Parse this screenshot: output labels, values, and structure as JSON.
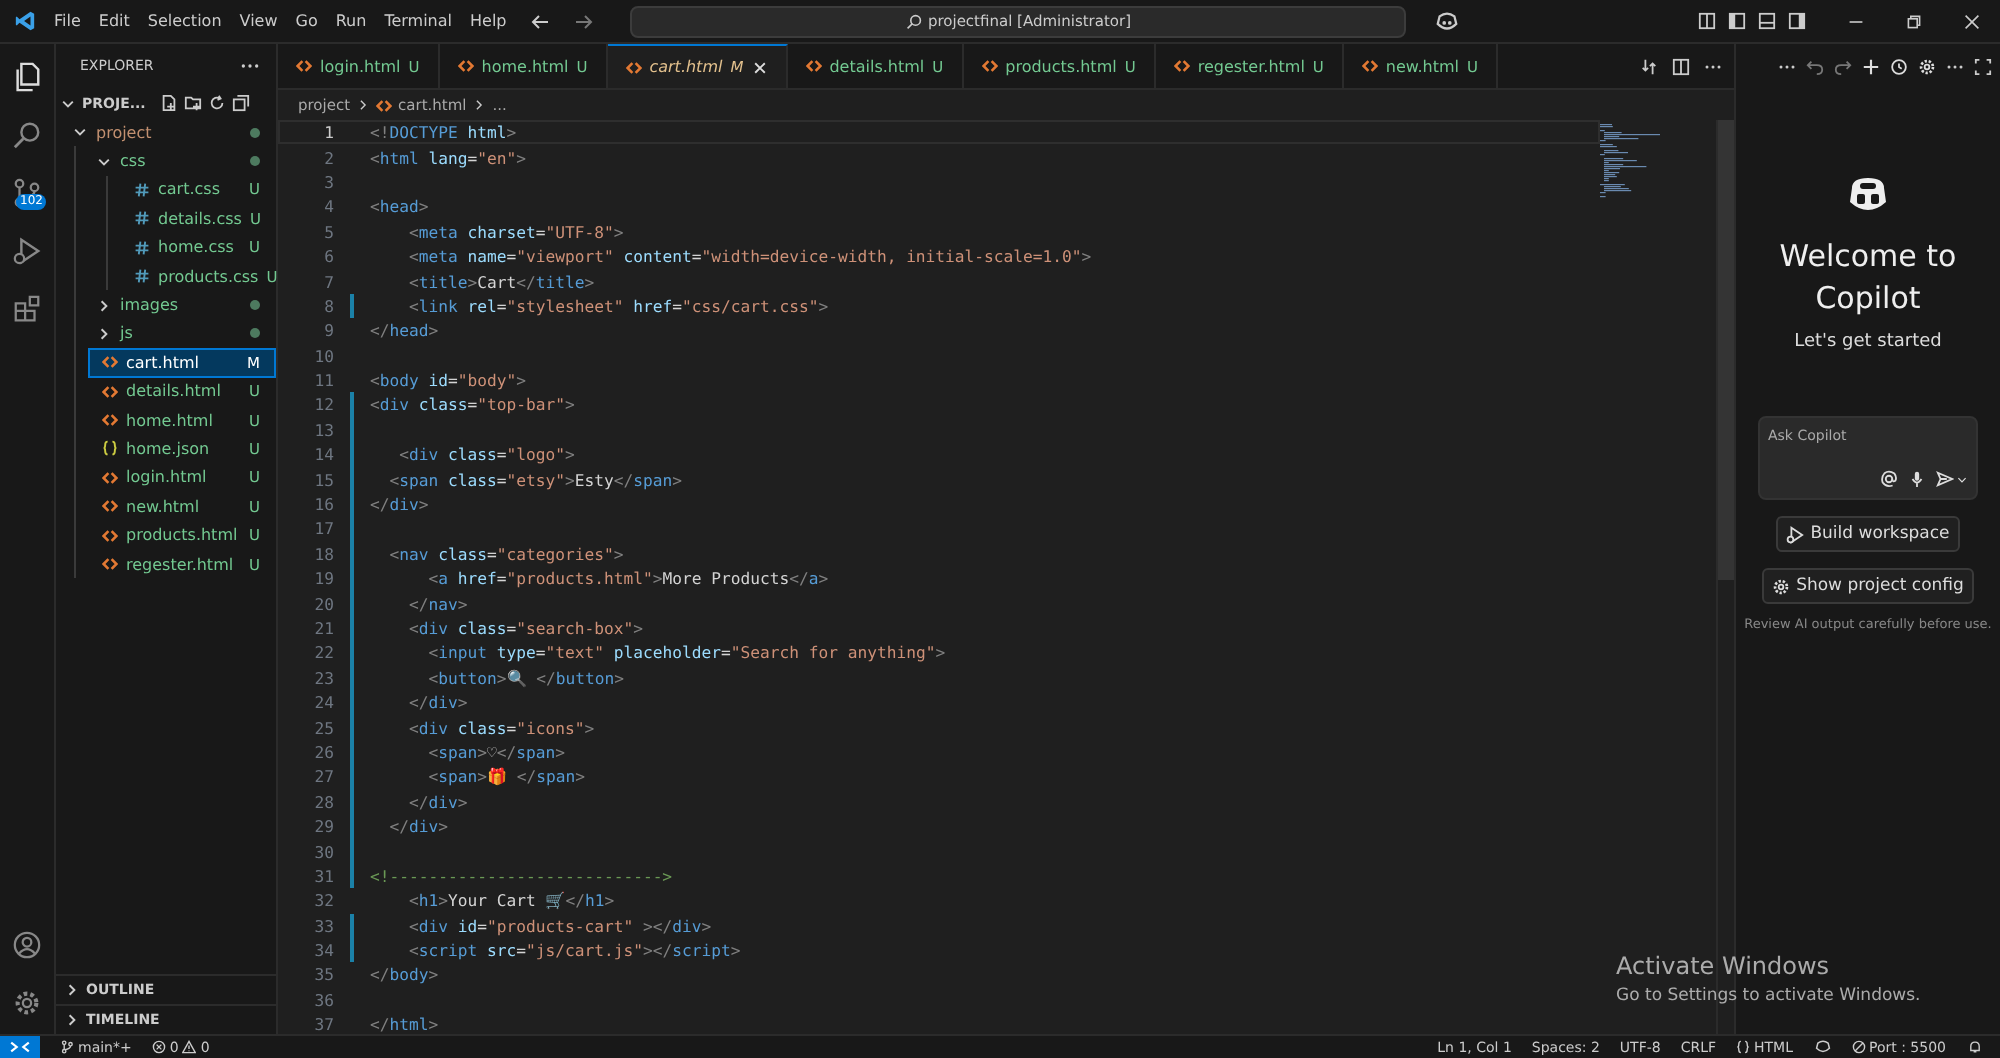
{
  "title_bar": {
    "menu": [
      "File",
      "Edit",
      "Selection",
      "View",
      "Go",
      "Run",
      "Terminal",
      "Help"
    ],
    "search": "projectfinal [Administrator]"
  },
  "activity_bar": {
    "source_control_badge": "102"
  },
  "explorer": {
    "title": "EXPLORER",
    "section": "PROJE...",
    "tree": [
      {
        "name": "project",
        "kind": "folder",
        "expanded": true,
        "children": [
          {
            "name": "css",
            "kind": "folder",
            "expanded": true,
            "children": [
              {
                "name": "cart.css",
                "kind": "css",
                "status": "U",
                "modified": false,
                "selected": false
              },
              {
                "name": "details.css",
                "kind": "css",
                "status": "U",
                "modified": false,
                "selected": false
              },
              {
                "name": "home.css",
                "kind": "css",
                "status": "U",
                "modified": false,
                "selected": false
              },
              {
                "name": "products.css",
                "kind": "css",
                "status": "U",
                "modified": false,
                "selected": false
              }
            ]
          },
          {
            "name": "images",
            "kind": "folder",
            "expanded": false
          },
          {
            "name": "js",
            "kind": "folder",
            "expanded": false
          },
          {
            "name": "cart.html",
            "kind": "html",
            "status": "M",
            "modified": true,
            "selected": true
          },
          {
            "name": "details.html",
            "kind": "html",
            "status": "U",
            "modified": false,
            "selected": false
          },
          {
            "name": "home.html",
            "kind": "html",
            "status": "U",
            "modified": false,
            "selected": false
          },
          {
            "name": "home.json",
            "kind": "json",
            "status": "U",
            "modified": false,
            "selected": false
          },
          {
            "name": "login.html",
            "kind": "html",
            "status": "U",
            "modified": false,
            "selected": false
          },
          {
            "name": "new.html",
            "kind": "html",
            "status": "U",
            "modified": false,
            "selected": false
          },
          {
            "name": "products.html",
            "kind": "html",
            "status": "U",
            "modified": false,
            "selected": false
          },
          {
            "name": "regester.html",
            "kind": "html",
            "status": "U",
            "modified": false,
            "selected": false
          }
        ]
      }
    ],
    "panels": [
      "OUTLINE",
      "TIMELINE"
    ]
  },
  "tabs": [
    {
      "label": "login.html",
      "status": "U",
      "modified": false,
      "selected": false
    },
    {
      "label": "home.html",
      "status": "U",
      "modified": false,
      "selected": false
    },
    {
      "label": "cart.html",
      "status": "M",
      "modified": true,
      "selected": true
    },
    {
      "label": "details.html",
      "status": "U",
      "modified": false,
      "selected": false
    },
    {
      "label": "products.html",
      "status": "U",
      "modified": false,
      "selected": false
    },
    {
      "label": "regester.html",
      "status": "U",
      "modified": false,
      "selected": false
    },
    {
      "label": "new.html",
      "status": "U",
      "modified": false,
      "selected": false
    }
  ],
  "breadcrumb": [
    "project",
    "cart.html",
    "..."
  ],
  "code": {
    "lines": [
      {
        "number": "1",
        "text": "<!DOCTYPE html>",
        "changed": false,
        "current": true
      },
      {
        "number": "2",
        "text": "<html lang=\"en\">",
        "changed": false,
        "current": false
      },
      {
        "number": "3",
        "changed": false,
        "current": false
      },
      {
        "number": "4",
        "text": "<head>",
        "changed": false,
        "current": false
      },
      {
        "number": "5",
        "text": "    <meta charset=\"UTF-8\">",
        "changed": false,
        "current": false
      },
      {
        "number": "6",
        "text": "    <meta name=\"viewport\" content=\"width=device-width, initial-scale=1.0\">",
        "changed": false,
        "current": false
      },
      {
        "number": "7",
        "text": "    <title>Cart</title>",
        "changed": false,
        "current": false
      },
      {
        "number": "8",
        "text": "    <link rel=\"stylesheet\" href=\"css/cart.css\">",
        "changed": true,
        "current": false
      },
      {
        "number": "9",
        "text": "</head>",
        "changed": false,
        "current": false
      },
      {
        "number": "10",
        "changed": false,
        "current": false
      },
      {
        "number": "11",
        "text": "<body id=\"body\">",
        "changed": false,
        "current": false
      },
      {
        "number": "12",
        "text": "<div class=\"top-bar\">",
        "changed": true,
        "current": false
      },
      {
        "number": "13",
        "changed": true,
        "current": false
      },
      {
        "number": "14",
        "text": "   <div class=\"logo\">",
        "changed": true,
        "current": false
      },
      {
        "number": "15",
        "text": "  <span class=\"etsy\">Esty</span>",
        "changed": true,
        "current": false
      },
      {
        "number": "16",
        "text": "</div>",
        "changed": true,
        "current": false
      },
      {
        "number": "17",
        "changed": true,
        "current": false
      },
      {
        "number": "18",
        "text": "  <nav class=\"categories\">",
        "changed": true,
        "current": false
      },
      {
        "number": "19",
        "text": "      <a href=\"products.html\">More Products</a>",
        "changed": true,
        "current": false
      },
      {
        "number": "20",
        "text": "    </nav>",
        "changed": true,
        "current": false
      },
      {
        "number": "21",
        "text": "    <div class=\"search-box\">",
        "changed": true,
        "current": false
      },
      {
        "number": "22",
        "text": "      <input type=\"text\" placeholder=\"Search for anything\">",
        "changed": true,
        "current": false
      },
      {
        "number": "23",
        "text": "      <button>🔍 </button>",
        "changed": true,
        "current": false
      },
      {
        "number": "24",
        "text": "    </div>",
        "changed": true,
        "current": false
      },
      {
        "number": "25",
        "text": "    <div class=\"icons\">",
        "changed": true,
        "current": false
      },
      {
        "number": "26",
        "text": "      <span>♡</span>",
        "changed": true,
        "current": false
      },
      {
        "number": "27",
        "text": "      <span>🎁 </span>",
        "changed": true,
        "current": false
      },
      {
        "number": "28",
        "text": "    </div>",
        "changed": true,
        "current": false
      },
      {
        "number": "29",
        "text": "  </div>",
        "changed": true,
        "current": false
      },
      {
        "number": "30",
        "changed": true,
        "current": false
      },
      {
        "number": "31",
        "text": "<!---------------------------->",
        "changed": true,
        "current": false
      },
      {
        "number": "32",
        "text": "    <h1>Your Cart 🛒</h1>",
        "changed": false,
        "current": false
      },
      {
        "number": "33",
        "text": "    <div id=\"products-cart\" ></div>",
        "changed": true,
        "current": false
      },
      {
        "number": "34",
        "text": "    <script src=\"js/cart.js\"></script>",
        "changed": true,
        "current": false
      },
      {
        "number": "35",
        "text": "</body>",
        "changed": false,
        "current": false
      },
      {
        "number": "36",
        "changed": false,
        "current": false
      },
      {
        "number": "37",
        "text": "</html>",
        "changed": false,
        "current": false
      }
    ]
  },
  "copilot": {
    "title": "Welcome to Copilot",
    "subtitle": "Let's get started",
    "input_placeholder": "Ask Copilot",
    "buttons": [
      {
        "label": "Build workspace",
        "kind": "build"
      },
      {
        "label": "Show project config",
        "kind": "config"
      }
    ],
    "notice": "Review AI output carefully before use."
  },
  "os_notice": {
    "title": "Activate Windows",
    "text": "Go to Settings to activate Windows."
  },
  "status_bar": {
    "branch": "main*+",
    "errors": "0",
    "warnings": "0",
    "position": "Ln 1, Col 1",
    "indent": "Spaces: 2",
    "encoding": "UTF-8",
    "eol": "CRLF",
    "language": "HTML",
    "port": "Port : 5500"
  }
}
